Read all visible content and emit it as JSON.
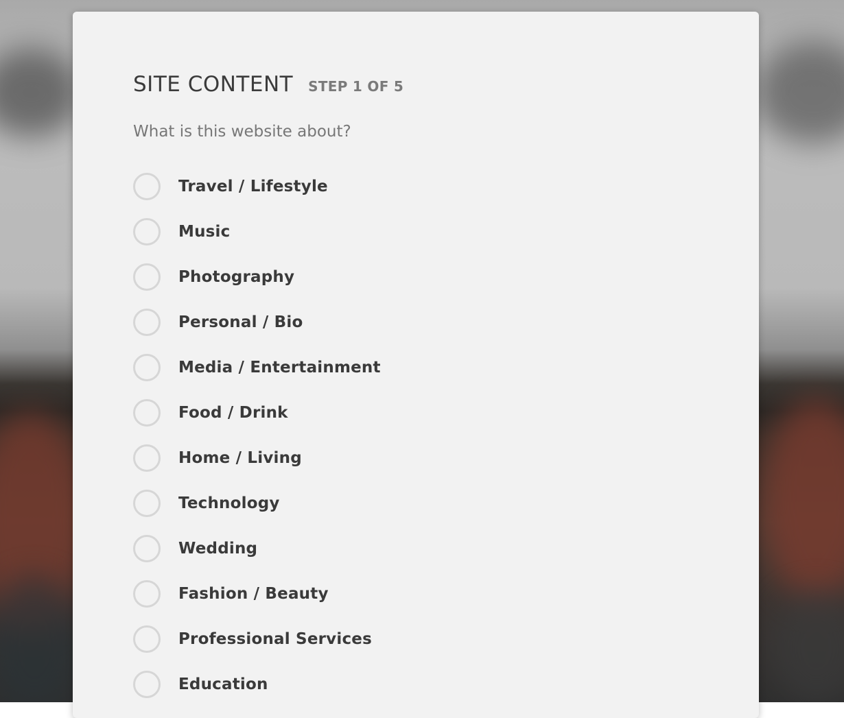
{
  "header": {
    "title": "SITE CONTENT",
    "step": "STEP 1 OF 5"
  },
  "question": "What is this website about?",
  "options": [
    {
      "label": "Travel / Lifestyle",
      "selected": false
    },
    {
      "label": "Music",
      "selected": false
    },
    {
      "label": "Photography",
      "selected": false
    },
    {
      "label": "Personal / Bio",
      "selected": false
    },
    {
      "label": "Media / Entertainment",
      "selected": false
    },
    {
      "label": "Food / Drink",
      "selected": false
    },
    {
      "label": "Home / Living",
      "selected": false
    },
    {
      "label": "Technology",
      "selected": false
    },
    {
      "label": "Wedding",
      "selected": false
    },
    {
      "label": "Fashion / Beauty",
      "selected": false
    },
    {
      "label": "Professional Services",
      "selected": false
    },
    {
      "label": "Education",
      "selected": false
    }
  ],
  "colors": {
    "panel_background": "#f2f2f2",
    "title_text": "#3b3b3b",
    "secondary_text": "#7a7a7a",
    "radio_border": "#d6d6d6"
  }
}
